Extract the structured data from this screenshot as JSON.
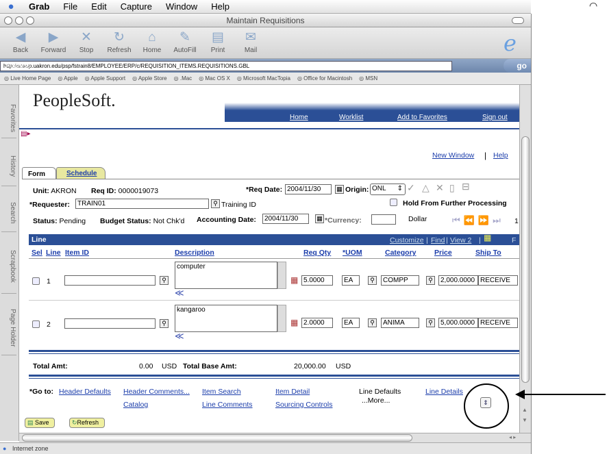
{
  "menubar": {
    "app": "Grab",
    "items": [
      "File",
      "Edit",
      "Capture",
      "Window",
      "Help"
    ]
  },
  "window": {
    "title": "Maintain Requisitions"
  },
  "toolbar": {
    "buttons": [
      {
        "label": "Back",
        "icon": "back-arrow-icon",
        "glyph": "◀"
      },
      {
        "label": "Forward",
        "icon": "forward-arrow-icon",
        "glyph": "▶"
      },
      {
        "label": "Stop",
        "icon": "stop-icon",
        "glyph": "✕"
      },
      {
        "label": "Refresh",
        "icon": "refresh-icon",
        "glyph": "↻"
      },
      {
        "label": "Home",
        "icon": "home-icon",
        "glyph": "⌂"
      },
      {
        "label": "AutoFill",
        "icon": "autofill-icon",
        "glyph": "✎"
      },
      {
        "label": "Print",
        "icon": "print-icon",
        "glyph": "▤"
      },
      {
        "label": "Mail",
        "icon": "mail-icon",
        "glyph": "✉"
      }
    ]
  },
  "address": {
    "label": "Address:",
    "url": "http://scaup.uakron.edu/psp/fstrain8/EMPLOYEE/ERP/c/REQUISITION_ITEMS.REQUISITIONS.GBL",
    "go": "go"
  },
  "favorites": [
    "Live Home Page",
    "Apple",
    "Apple Support",
    "Apple Store",
    ".Mac",
    "Mac OS X",
    "Microsoft MacTopia",
    "Office for Macintosh",
    "MSN"
  ],
  "sidetabs": [
    "Favorites",
    "History",
    "Search",
    "Scrapbook",
    "Page Holder"
  ],
  "ps": {
    "logo": "PeopleSoft.",
    "nav": [
      "Home",
      "Worklist",
      "Add to Favorites",
      "Sign out"
    ],
    "new_window": "New Window",
    "help": "Help",
    "sep": "|"
  },
  "tabs": {
    "form": "Form",
    "schedule": "Schedule"
  },
  "header": {
    "unit_label": "Unit:",
    "unit": "AKRON",
    "reqid_label": "Req ID:",
    "reqid": "0000019073",
    "reqdate_label": "*Req Date:",
    "reqdate": "2004/11/30",
    "origin_label": "Origin:",
    "origin": "ONL",
    "requester_label": "*Requester:",
    "requester": "TRAIN01",
    "requester_desc": "Training ID",
    "hold_label": "Hold From Further Processing",
    "status_label": "Status:",
    "status": "Pending",
    "budget_label": "Budget Status:",
    "budget": "Not Chk'd",
    "acctdate_label": "Accounting Date:",
    "acctdate": "2004/11/30",
    "currency_label": "*Currency:",
    "currency": "",
    "currency_name": "Dollar",
    "page": "1"
  },
  "grid": {
    "title": "Line",
    "customize": "Customize",
    "find": "Find",
    "view2": "View 2",
    "pipe": "|",
    "first": "F",
    "columns": [
      "Sel",
      "Line",
      "Item ID",
      "Description",
      "Req Qty",
      "*UOM",
      "Category",
      "Price",
      "Ship To"
    ],
    "rows": [
      {
        "line": "1",
        "item": "",
        "desc": "computer",
        "qty": "5.0000",
        "uom": "EA",
        "cat": "COMPP",
        "price": "2,000.0000",
        "ship": "RECEIVE"
      },
      {
        "line": "2",
        "item": "",
        "desc": "kangaroo",
        "qty": "2.0000",
        "uom": "EA",
        "cat": "ANIMA",
        "price": "5,000.0000",
        "ship": "RECEIVE"
      }
    ]
  },
  "totals": {
    "total_label": "Total Amt:",
    "total": "0.00",
    "cur": "USD",
    "base_label": "Total Base Amt:",
    "base": "20,000.00",
    "base_cur": "USD"
  },
  "goto": {
    "label": "*Go to:",
    "links": [
      "Header Defaults",
      "Header Comments...",
      "Item Search",
      "Item Detail",
      "Line Defaults",
      "Line Details",
      "Catalog",
      "Line Comments",
      "Sourcing Controls",
      "...More..."
    ]
  },
  "actions": {
    "save": "Save",
    "refresh": "Refresh"
  },
  "status_bar": "Internet zone"
}
